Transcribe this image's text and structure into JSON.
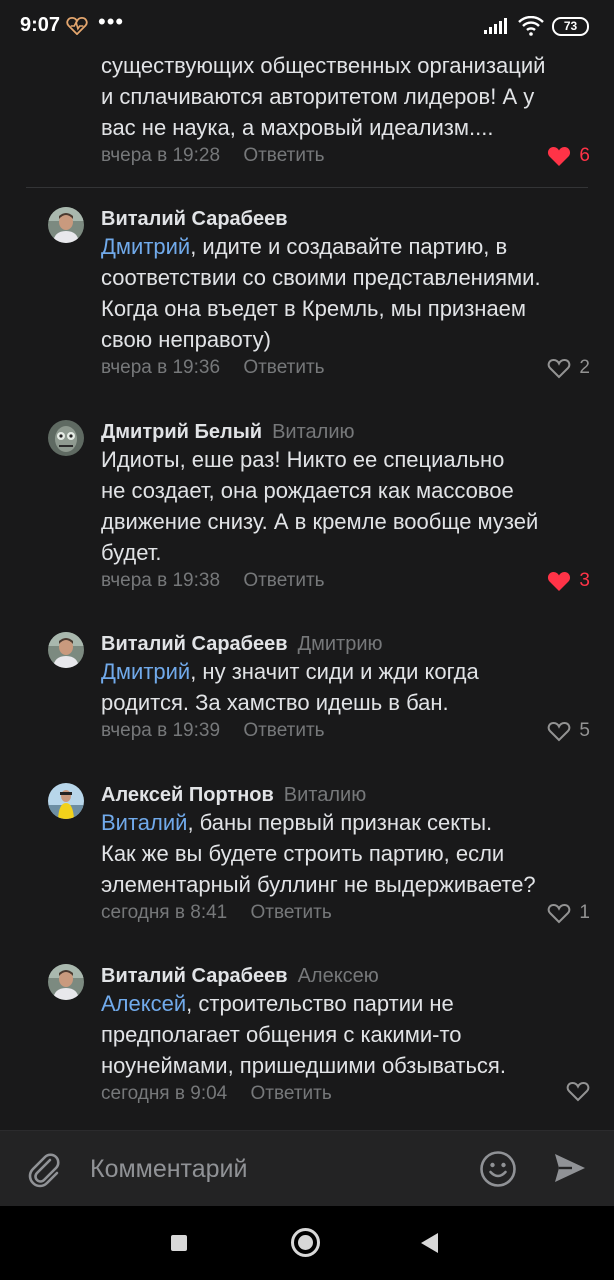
{
  "status_bar": {
    "time": "9:07",
    "dots": "•••",
    "battery": "73"
  },
  "comments": [
    {
      "text_lines": [
        "существующих общественных организаций",
        "и сплачиваются авторитетом лидеров! А у",
        "вас не наука, а махровый идеализм...."
      ],
      "time": "вчера в 19:28",
      "reply_label": "Ответить",
      "likes": "6",
      "liked": true
    },
    {
      "author": "Виталий Сарабеев",
      "reply_to": "",
      "mention": "Дмитрий",
      "text_lines": [
        ", идите и создавайте партию, в",
        "соответствии со своими представлениями.",
        "Когда она въедет в Кремль, мы признаем",
        "свою неправоту)"
      ],
      "time": "вчера в 19:36",
      "reply_label": "Ответить",
      "likes": "2",
      "liked": false
    },
    {
      "author": "Дмитрий Белый",
      "reply_to": "Виталию",
      "mention": "",
      "text_lines": [
        "Идиоты, еше раз! Никто ее специально",
        "не создает, она рождается как массовое",
        "движение снизу. А в кремле вообще музей",
        "будет."
      ],
      "time": "вчера в 19:38",
      "reply_label": "Ответить",
      "likes": "3",
      "liked": true
    },
    {
      "author": "Виталий Сарабеев",
      "reply_to": "Дмитрию",
      "mention": "Дмитрий",
      "text_lines": [
        ", ну значит сиди и жди когда",
        "родится. За хамство идешь в бан."
      ],
      "time": "вчера в 19:39",
      "reply_label": "Ответить",
      "likes": "5",
      "liked": false
    },
    {
      "author": "Алексей Портнов",
      "reply_to": "Виталию",
      "mention": "Виталий",
      "text_lines": [
        ", баны первый признак секты.",
        "Как же вы будете строить партию, если",
        "элементарный буллинг не выдерживаете?"
      ],
      "time": "сегодня в 8:41",
      "reply_label": "Ответить",
      "likes": "1",
      "liked": false
    },
    {
      "author": "Виталий Сарабеев",
      "reply_to": "Алексею",
      "mention": "Алексей",
      "text_lines": [
        ", строительство партии не",
        "предполагает общения с какими-то",
        "ноунеймами, пришедшими обзываться."
      ],
      "time": "сегодня в 9:04",
      "reply_label": "Ответить",
      "likes": "",
      "liked": false
    }
  ],
  "composer": {
    "placeholder": "Комментарий"
  },
  "colors": {
    "background": "#19191a",
    "mention": "#71aaeb",
    "liked": "#ff3347",
    "meta": "#76787a"
  },
  "icons": [
    "heart-status-icon",
    "signal-icon",
    "wifi-icon",
    "attach-icon",
    "emoji-icon",
    "send-icon",
    "heart-icon"
  ]
}
